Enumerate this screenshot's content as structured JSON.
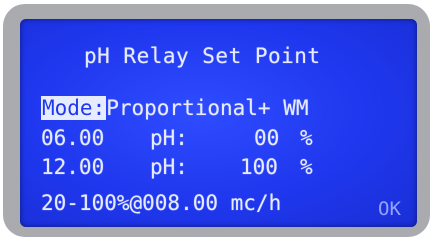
{
  "screen": {
    "title": "pH Relay Set Point",
    "mode_label": "Mode:",
    "mode_value": "Proportional+ WM",
    "rows": [
      {
        "value": "06.00",
        "unit": "pH:",
        "percent": "00",
        "percent_sign": "%"
      },
      {
        "value": "12.00",
        "unit": "pH:",
        "percent": "100",
        "percent_sign": "%"
      }
    ],
    "dosing_line": "20-100%@008.00 mc/h",
    "ok_label": "OK"
  },
  "colors": {
    "lcd_background": "#1f37ee",
    "lcd_text": "#e6ebff",
    "bezel": "#a9abaf"
  }
}
